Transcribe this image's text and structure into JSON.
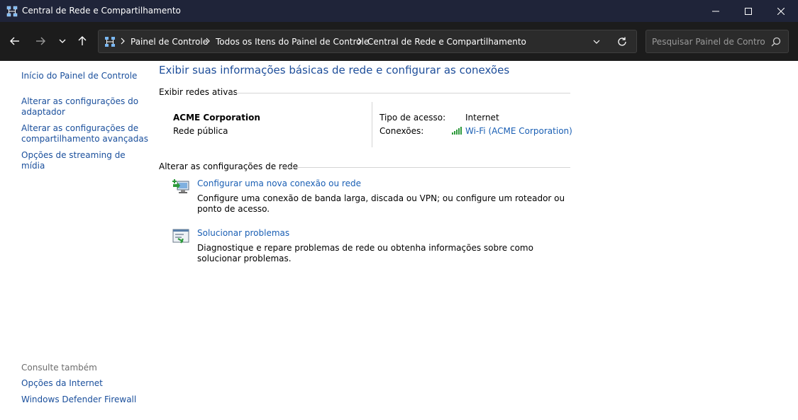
{
  "window": {
    "title": "Central de Rede e Compartilhamento"
  },
  "address_bar": {
    "crumbs": [
      "Painel de Controle",
      "Todos os Itens do Painel de Controle",
      "Central de Rede e Compartilhamento"
    ]
  },
  "search": {
    "placeholder": "Pesquisar Painel de Controle"
  },
  "sidebar": {
    "links": [
      "Início do Painel de Controle",
      "Alterar as configurações do adaptador",
      "Alterar as configurações de compartilhamento avançadas",
      "Opções de streaming de mídia"
    ],
    "see_also_title": "Consulte também",
    "see_also": [
      "Opções da Internet",
      "Windows Defender Firewall"
    ]
  },
  "main": {
    "heading": "Exibir suas informações básicas de rede e configurar as conexões",
    "active_networks_title": "Exibir redes ativas",
    "network": {
      "name": "ACME Corporation",
      "category": "Rede pública",
      "access_type_label": "Tipo de acesso:",
      "access_type_value": "Internet",
      "connections_label": "Conexões:",
      "connection_link": "Wi-Fi (ACME Corporation)"
    },
    "change_settings_title": "Alterar as configurações de rede",
    "tasks": [
      {
        "link": "Configurar uma nova conexão ou rede",
        "description": "Configure uma conexão de banda larga, discada ou VPN; ou configure um roteador ou ponto de acesso."
      },
      {
        "link": "Solucionar problemas",
        "description": "Diagnostique e repare problemas de rede ou obtenha informações sobre como solucionar problemas."
      }
    ]
  },
  "icons": {
    "app": "network-center-icon",
    "back": "arrow-left-icon",
    "forward": "arrow-right-icon",
    "recent": "chevron-down-icon",
    "up": "arrow-up-icon",
    "refresh": "refresh-icon",
    "search": "search-icon",
    "wifi": "wifi-signal-icon"
  },
  "colors": {
    "titlebar": "#1f2439",
    "navbar": "#1c1c1c",
    "link": "#1a5fb4",
    "heading": "#1e4e9a",
    "wifi_green": "#2e9a3c"
  }
}
